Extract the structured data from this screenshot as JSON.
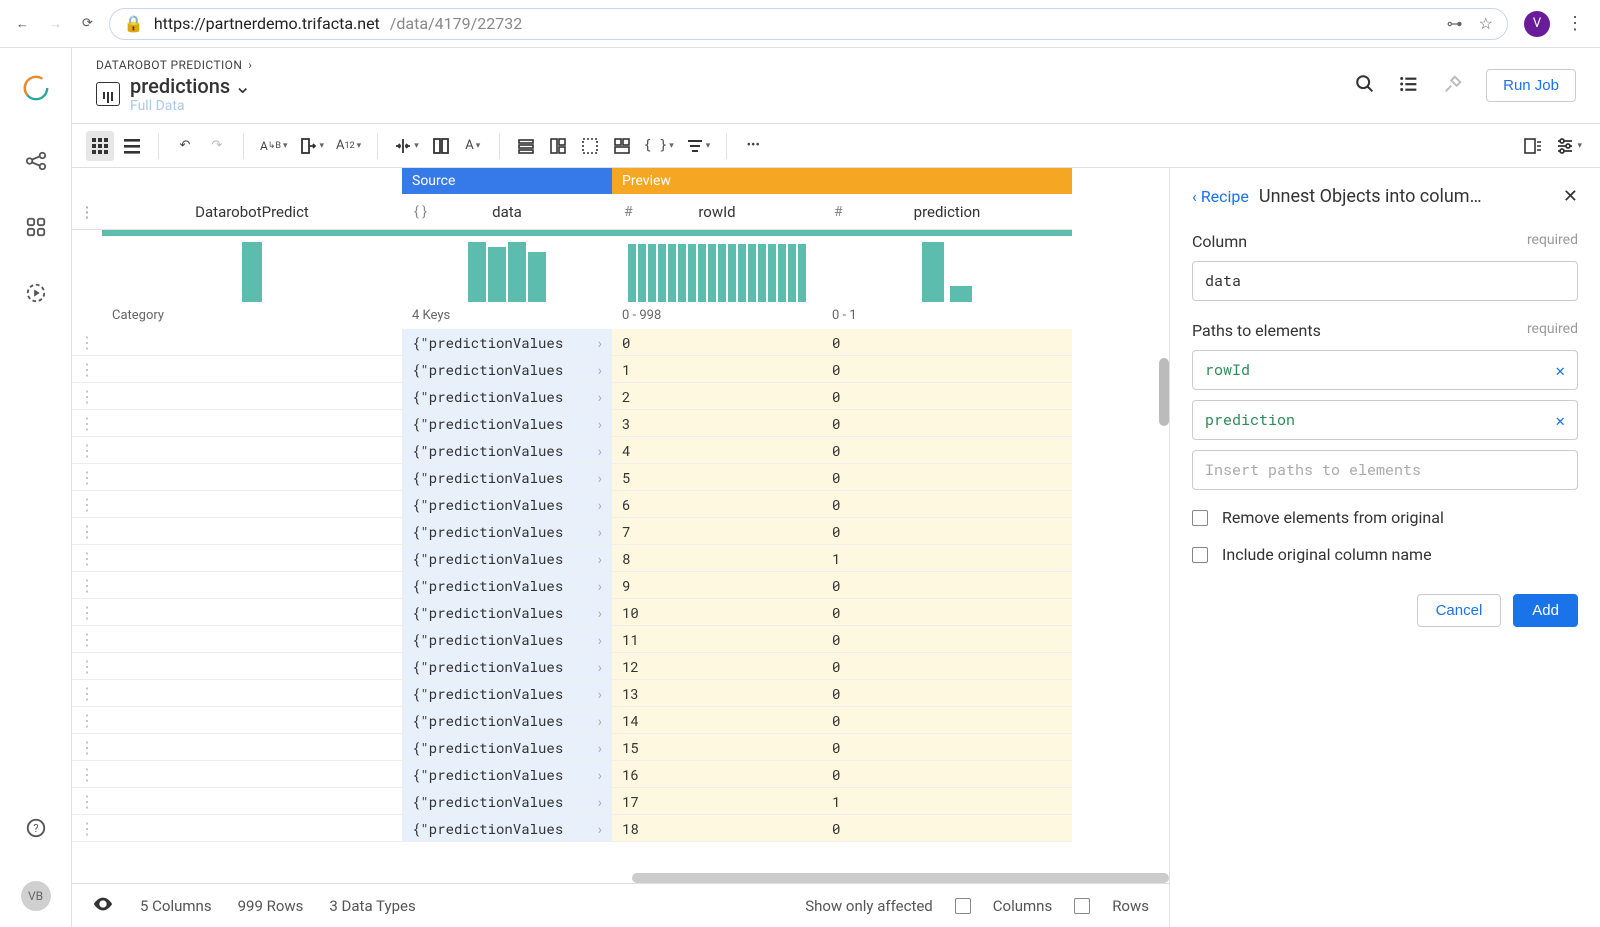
{
  "chrome": {
    "url_host": "https://partnerdemo.trifacta.net",
    "url_path": "/data/4179/22732",
    "avatar": "V"
  },
  "rail": {
    "avatar": "VB"
  },
  "header": {
    "breadcrumb": "DATAROBOT PREDICTION",
    "title": "predictions",
    "subtitle": "Full Data",
    "run_label": "Run Job"
  },
  "grid": {
    "ribbon_source": "Source",
    "ribbon_preview": "Preview",
    "columns": [
      {
        "name": "DatarobotPredict",
        "type_icon": ""
      },
      {
        "name": "data",
        "type_icon": "{ }"
      },
      {
        "name": "rowId",
        "type_icon": "#"
      },
      {
        "name": "prediction",
        "type_icon": "#"
      }
    ],
    "meta": {
      "c0": "Category",
      "c1": "4 Keys",
      "c2": "0 - 998",
      "c3": "0 - 1"
    },
    "obj_cell": "{\"predictionValues",
    "rows": [
      {
        "rowId": "0",
        "prediction": "0"
      },
      {
        "rowId": "1",
        "prediction": "0"
      },
      {
        "rowId": "2",
        "prediction": "0"
      },
      {
        "rowId": "3",
        "prediction": "0"
      },
      {
        "rowId": "4",
        "prediction": "0"
      },
      {
        "rowId": "5",
        "prediction": "0"
      },
      {
        "rowId": "6",
        "prediction": "0"
      },
      {
        "rowId": "7",
        "prediction": "0"
      },
      {
        "rowId": "8",
        "prediction": "1"
      },
      {
        "rowId": "9",
        "prediction": "0"
      },
      {
        "rowId": "10",
        "prediction": "0"
      },
      {
        "rowId": "11",
        "prediction": "0"
      },
      {
        "rowId": "12",
        "prediction": "0"
      },
      {
        "rowId": "13",
        "prediction": "0"
      },
      {
        "rowId": "14",
        "prediction": "0"
      },
      {
        "rowId": "15",
        "prediction": "0"
      },
      {
        "rowId": "16",
        "prediction": "0"
      },
      {
        "rowId": "17",
        "prediction": "1"
      },
      {
        "rowId": "18",
        "prediction": "0"
      }
    ]
  },
  "status": {
    "columns": "5 Columns",
    "rows": "999 Rows",
    "types": "3 Data Types",
    "affected": "Show only affected",
    "cols_label": "Columns",
    "rows_label": "Rows"
  },
  "panel": {
    "back": "Recipe",
    "title": "Unnest Objects into colum…",
    "column_label": "Column",
    "required": "required",
    "column_value": "data",
    "paths_label": "Paths to elements",
    "paths": [
      "rowId",
      "prediction"
    ],
    "paths_placeholder": "Insert paths to elements",
    "opt_remove": "Remove elements from original",
    "opt_include": "Include original column name",
    "cancel": "Cancel",
    "add": "Add"
  }
}
